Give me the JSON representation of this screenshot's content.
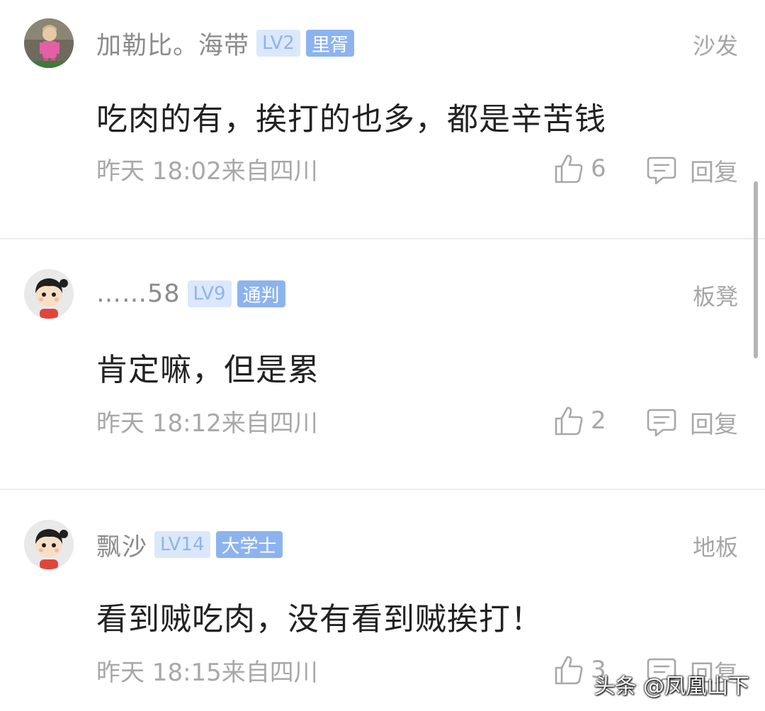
{
  "comments": [
    {
      "username": "加勒比。海带",
      "level": "LV2",
      "title": "里胥",
      "floor": "沙发",
      "content": "吃肉的有，挨打的也多，都是辛苦钱",
      "time": "昨天 18:02来自四川",
      "likes": "6",
      "reply_label": "回复",
      "avatar": "photo-avatar"
    },
    {
      "username": "……58",
      "level": "LV9",
      "title": "通判",
      "floor": "板凳",
      "content": "肯定嘛，但是累",
      "time": "昨天 18:12来自四川",
      "likes": "2",
      "reply_label": "回复",
      "avatar": "cartoon-avatar"
    },
    {
      "username": "飘沙",
      "level": "LV14",
      "title": "大学士",
      "floor": "地板",
      "content": "看到贼吃肉，没有看到贼挨打！",
      "time": "昨天 18:15来自四川",
      "likes": "3",
      "reply_label": "回复",
      "avatar": "cartoon-avatar"
    }
  ],
  "watermark": "头条 @凤凰山下",
  "colors": {
    "level_badge_bg": "#dbe8fb",
    "title_badge_bg": "#8db3ef",
    "meta_text": "#a8a8a8"
  }
}
